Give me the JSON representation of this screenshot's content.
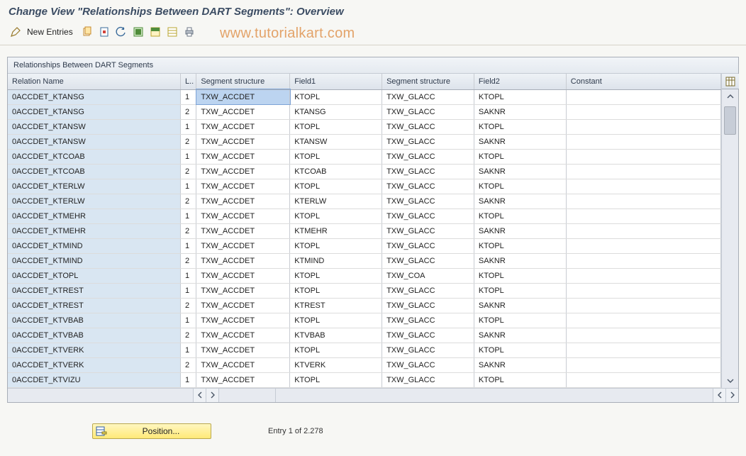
{
  "title": "Change View \"Relationships Between DART Segments\": Overview",
  "toolbar": {
    "new_entries_label": "New Entries"
  },
  "watermark": "www.tutorialkart.com",
  "panel_title": "Relationships Between DART Segments",
  "columns": {
    "relation": "Relation Name",
    "l": "L..",
    "seg1": "Segment structure",
    "f1": "Field1",
    "seg2": "Segment structure",
    "f2": "Field2",
    "constant": "Constant"
  },
  "rows": [
    {
      "relation": "0ACCDET_KTANSG",
      "l": "1",
      "seg1": "TXW_ACCDET",
      "f1": "KTOPL",
      "seg2": "TXW_GLACC",
      "f2": "KTOPL",
      "constant": ""
    },
    {
      "relation": "0ACCDET_KTANSG",
      "l": "2",
      "seg1": "TXW_ACCDET",
      "f1": "KTANSG",
      "seg2": "TXW_GLACC",
      "f2": "SAKNR",
      "constant": ""
    },
    {
      "relation": "0ACCDET_KTANSW",
      "l": "1",
      "seg1": "TXW_ACCDET",
      "f1": "KTOPL",
      "seg2": "TXW_GLACC",
      "f2": "KTOPL",
      "constant": ""
    },
    {
      "relation": "0ACCDET_KTANSW",
      "l": "2",
      "seg1": "TXW_ACCDET",
      "f1": "KTANSW",
      "seg2": "TXW_GLACC",
      "f2": "SAKNR",
      "constant": ""
    },
    {
      "relation": "0ACCDET_KTCOAB",
      "l": "1",
      "seg1": "TXW_ACCDET",
      "f1": "KTOPL",
      "seg2": "TXW_GLACC",
      "f2": "KTOPL",
      "constant": ""
    },
    {
      "relation": "0ACCDET_KTCOAB",
      "l": "2",
      "seg1": "TXW_ACCDET",
      "f1": "KTCOAB",
      "seg2": "TXW_GLACC",
      "f2": "SAKNR",
      "constant": ""
    },
    {
      "relation": "0ACCDET_KTERLW",
      "l": "1",
      "seg1": "TXW_ACCDET",
      "f1": "KTOPL",
      "seg2": "TXW_GLACC",
      "f2": "KTOPL",
      "constant": ""
    },
    {
      "relation": "0ACCDET_KTERLW",
      "l": "2",
      "seg1": "TXW_ACCDET",
      "f1": "KTERLW",
      "seg2": "TXW_GLACC",
      "f2": "SAKNR",
      "constant": ""
    },
    {
      "relation": "0ACCDET_KTMEHR",
      "l": "1",
      "seg1": "TXW_ACCDET",
      "f1": "KTOPL",
      "seg2": "TXW_GLACC",
      "f2": "KTOPL",
      "constant": ""
    },
    {
      "relation": "0ACCDET_KTMEHR",
      "l": "2",
      "seg1": "TXW_ACCDET",
      "f1": "KTMEHR",
      "seg2": "TXW_GLACC",
      "f2": "SAKNR",
      "constant": ""
    },
    {
      "relation": "0ACCDET_KTMIND",
      "l": "1",
      "seg1": "TXW_ACCDET",
      "f1": "KTOPL",
      "seg2": "TXW_GLACC",
      "f2": "KTOPL",
      "constant": ""
    },
    {
      "relation": "0ACCDET_KTMIND",
      "l": "2",
      "seg1": "TXW_ACCDET",
      "f1": "KTMIND",
      "seg2": "TXW_GLACC",
      "f2": "SAKNR",
      "constant": ""
    },
    {
      "relation": "0ACCDET_KTOPL",
      "l": "1",
      "seg1": "TXW_ACCDET",
      "f1": "KTOPL",
      "seg2": "TXW_COA",
      "f2": "KTOPL",
      "constant": ""
    },
    {
      "relation": "0ACCDET_KTREST",
      "l": "1",
      "seg1": "TXW_ACCDET",
      "f1": "KTOPL",
      "seg2": "TXW_GLACC",
      "f2": "KTOPL",
      "constant": ""
    },
    {
      "relation": "0ACCDET_KTREST",
      "l": "2",
      "seg1": "TXW_ACCDET",
      "f1": "KTREST",
      "seg2": "TXW_GLACC",
      "f2": "SAKNR",
      "constant": ""
    },
    {
      "relation": "0ACCDET_KTVBAB",
      "l": "1",
      "seg1": "TXW_ACCDET",
      "f1": "KTOPL",
      "seg2": "TXW_GLACC",
      "f2": "KTOPL",
      "constant": ""
    },
    {
      "relation": "0ACCDET_KTVBAB",
      "l": "2",
      "seg1": "TXW_ACCDET",
      "f1": "KTVBAB",
      "seg2": "TXW_GLACC",
      "f2": "SAKNR",
      "constant": ""
    },
    {
      "relation": "0ACCDET_KTVERK",
      "l": "1",
      "seg1": "TXW_ACCDET",
      "f1": "KTOPL",
      "seg2": "TXW_GLACC",
      "f2": "KTOPL",
      "constant": ""
    },
    {
      "relation": "0ACCDET_KTVERK",
      "l": "2",
      "seg1": "TXW_ACCDET",
      "f1": "KTVERK",
      "seg2": "TXW_GLACC",
      "f2": "SAKNR",
      "constant": ""
    },
    {
      "relation": "0ACCDET_KTVIZU",
      "l": "1",
      "seg1": "TXW_ACCDET",
      "f1": "KTOPL",
      "seg2": "TXW_GLACC",
      "f2": "KTOPL",
      "constant": ""
    }
  ],
  "footer": {
    "position_label": "Position...",
    "entry_text": "Entry 1 of 2.278"
  }
}
